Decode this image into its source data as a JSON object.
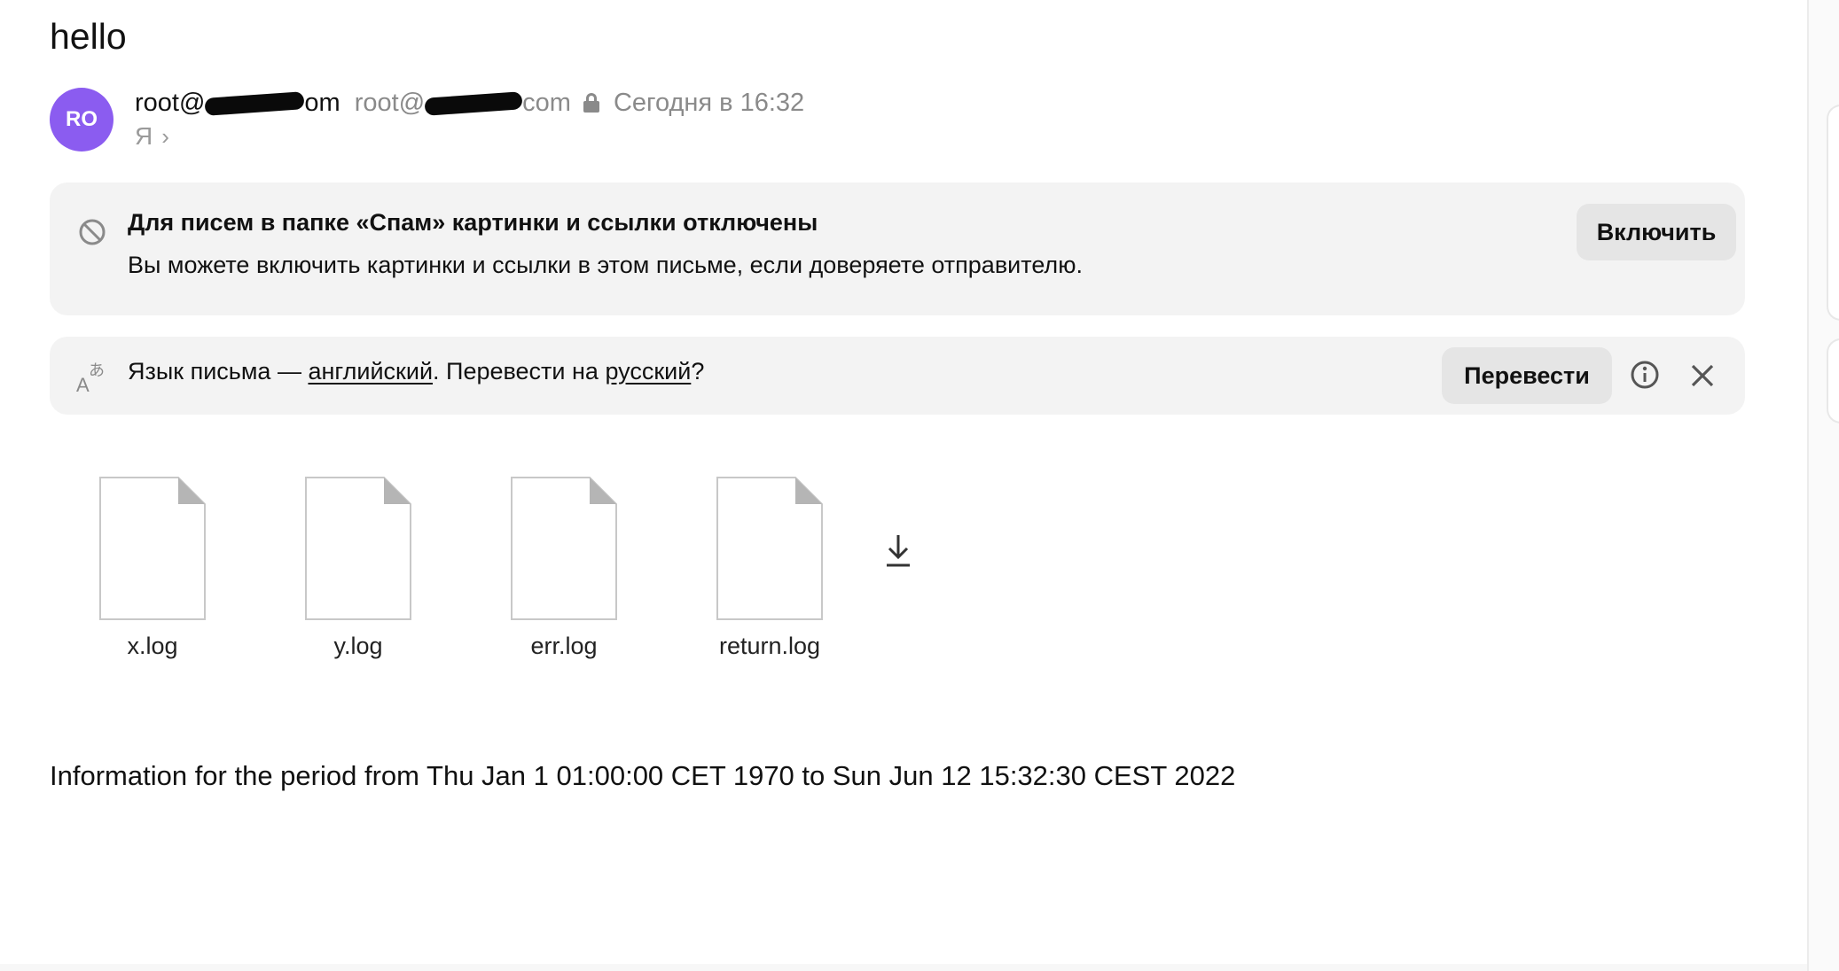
{
  "email": {
    "subject": "hello",
    "sender": {
      "avatar_initials": "RO",
      "name_prefix": "root@",
      "name_suffix": "om",
      "email_prefix": "root@",
      "email_suffix": "com",
      "date": "Сегодня в 16:32",
      "recipient": "Я",
      "lock_icon": "lock-icon",
      "avatar_color": "#8b5cf0"
    },
    "spam_banner": {
      "title": "Для писем в папке «Спам» картинки и ссылки отключены",
      "text": "Вы можете включить картинки и ссылки в этом письме, если доверяете отправителю.",
      "button": "Включить",
      "icon": "block-icon"
    },
    "translate_banner": {
      "text_prefix": "Язык письма — ",
      "from_lang": "английский",
      "text_middle": ". Перевести на ",
      "to_lang": "русский",
      "text_suffix": "?",
      "button": "Перевести",
      "icon": "translate-icon",
      "info_icon": "info-icon",
      "close_icon": "close-icon"
    },
    "attachments": [
      {
        "name": "x.log"
      },
      {
        "name": "y.log"
      },
      {
        "name": "err.log"
      },
      {
        "name": "return.log"
      }
    ],
    "download_icon": "download-icon",
    "body": "Information for the period from Thu Jan 1 01:00:00 CET 1970 to Sun Jun 12 15:32:30 CEST 2022"
  }
}
